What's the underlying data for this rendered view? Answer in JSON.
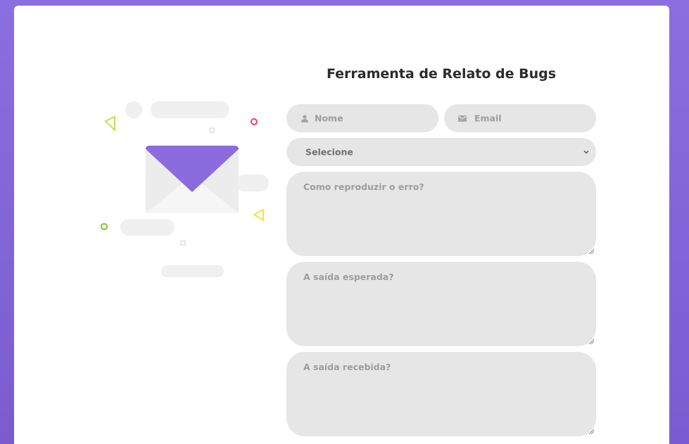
{
  "page": {
    "title": "Ferramenta de Relato de Bugs"
  },
  "form": {
    "name": {
      "placeholder": "Nome",
      "icon": "user-icon"
    },
    "email": {
      "placeholder": "Email",
      "icon": "envelope-icon"
    },
    "category": {
      "selected": "Selecione"
    },
    "steps": {
      "placeholder": "Como reproduzir o erro?"
    },
    "expected": {
      "placeholder": "A saída esperada?"
    },
    "received": {
      "placeholder": "A saída recebida?"
    }
  },
  "colors": {
    "accent": "#8c6ddf",
    "field_bg": "#e6e6e6",
    "placeholder": "#9d9d9d",
    "envelope_flap": "#8a6cde",
    "deco_green": "#8dc63f",
    "deco_yellow": "#f5e63c",
    "deco_red": "#f0455a"
  }
}
